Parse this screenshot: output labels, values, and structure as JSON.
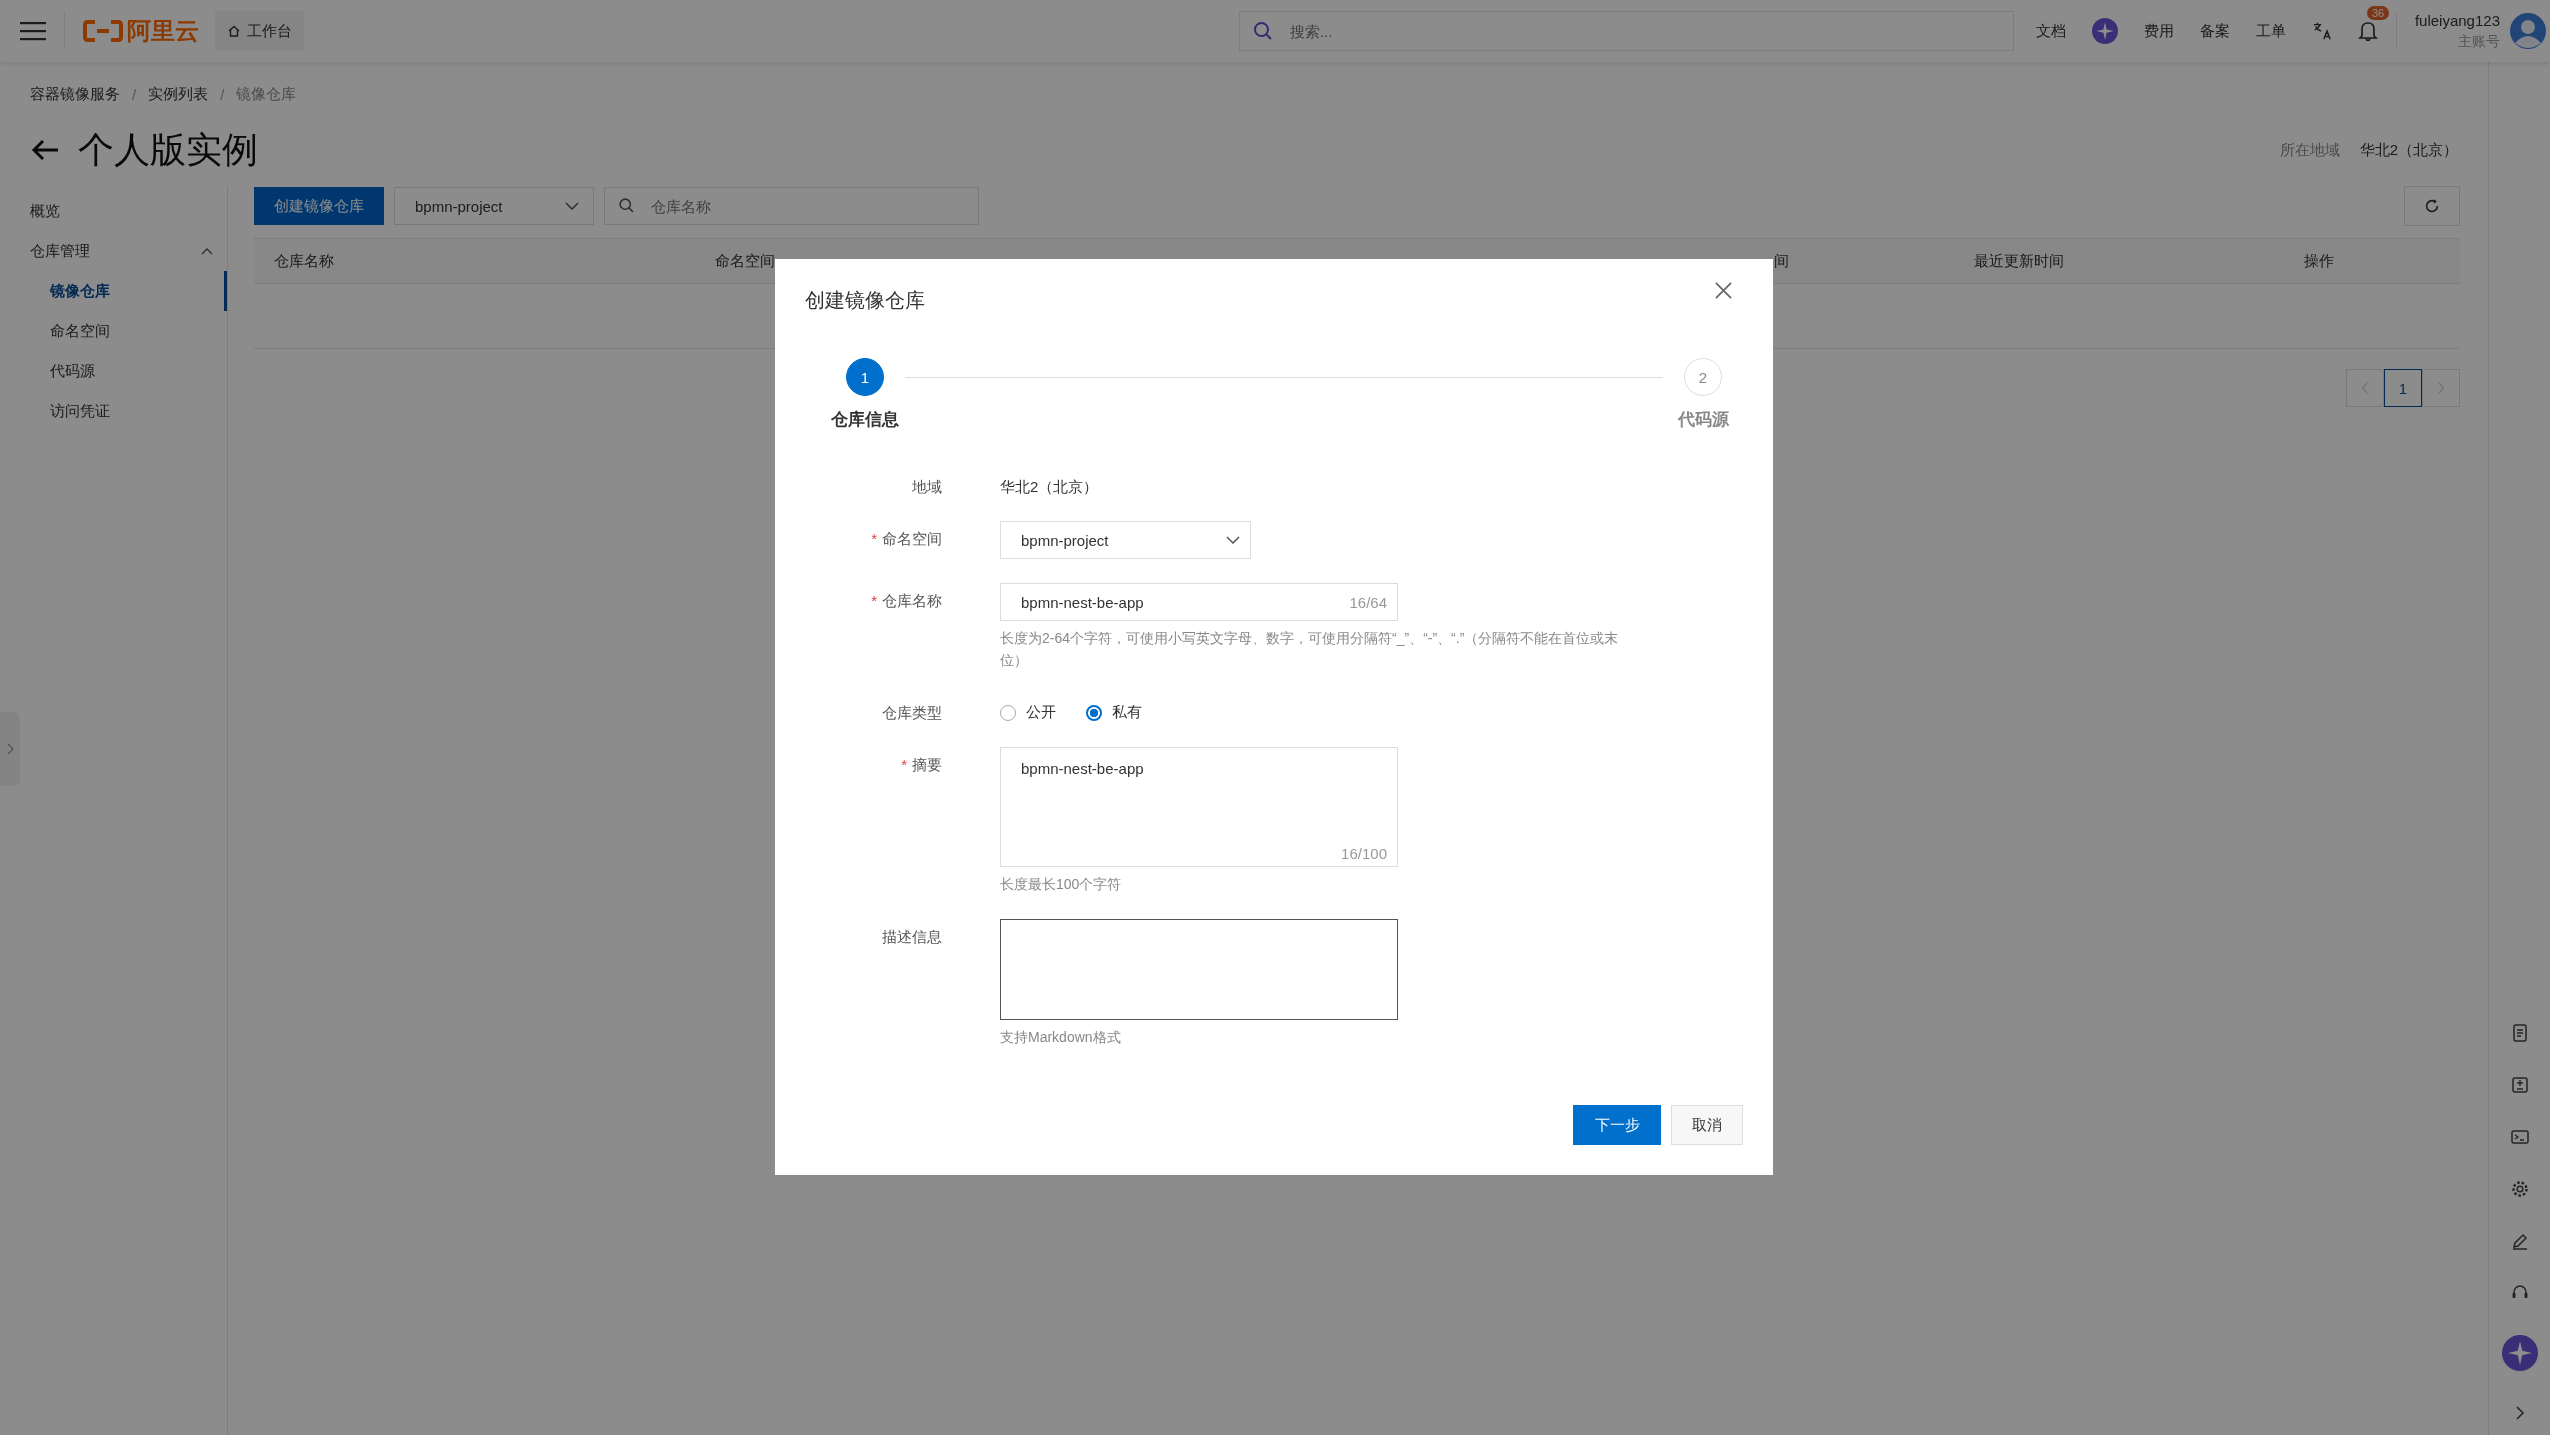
{
  "topbar": {
    "logo": "阿里云",
    "workbench": "工作台",
    "search": {
      "placeholder": "搜索..."
    },
    "items": [
      {
        "kind": "text",
        "label": "文档"
      },
      {
        "kind": "assistant"
      },
      {
        "kind": "text",
        "label": "费用"
      },
      {
        "kind": "text",
        "label": "备案"
      },
      {
        "kind": "text",
        "label": "工单"
      },
      {
        "kind": "translate"
      },
      {
        "kind": "bell",
        "badge": "36"
      }
    ],
    "user": {
      "name": "fuleiyang123",
      "account": "主账号"
    }
  },
  "breadcrumb": {
    "separator": "/",
    "items": [
      {
        "label": "容器镜像服务",
        "selected": false
      },
      {
        "label": "实例列表",
        "selected": false
      },
      {
        "label": "镜像仓库",
        "selected": true
      }
    ]
  },
  "page_title": "个人版实例",
  "region": {
    "label": "所在地域",
    "value": "华北2（北京）"
  },
  "sidebar": {
    "items": [
      {
        "label": "概览",
        "selected": false
      },
      {
        "label": "仓库管理",
        "selected": false,
        "expanded": true,
        "children": [
          {
            "label": "镜像仓库",
            "selected": true
          },
          {
            "label": "命名空间",
            "selected": false
          },
          {
            "label": "代码源",
            "selected": false
          },
          {
            "label": "访问凭证",
            "selected": false
          }
        ]
      }
    ]
  },
  "toolbar": {
    "create_button": "创建镜像仓库",
    "namespace_select": "bpmn-project",
    "search": {
      "placeholder": "仓库名称"
    }
  },
  "table": {
    "columns": [
      "仓库名称",
      "命名空间",
      "间",
      "最近更新时间",
      "操作"
    ]
  },
  "pagination": {
    "pages": [
      {
        "label": "1",
        "selected": true
      }
    ],
    "prev_disabled": true,
    "next_disabled": true
  },
  "dialog": {
    "title": "创建镜像仓库",
    "required_mark": "*",
    "steps": [
      {
        "number": "1",
        "label": "仓库信息",
        "selected": true
      },
      {
        "number": "2",
        "label": "代码源",
        "selected": false
      }
    ],
    "fields": [
      {
        "kind": "text",
        "label": "地域",
        "required": false,
        "value": "华北2（北京）"
      },
      {
        "kind": "select",
        "label": "命名空间",
        "required": true,
        "value": "bpmn-project"
      },
      {
        "kind": "input",
        "label": "仓库名称",
        "required": true,
        "value": "bpmn-nest-be-app",
        "counter": "16/64",
        "hint": "长度为2-64个字符，可使用小写英文字母、数字，可使用分隔符“_”、“-”、“.”（分隔符不能在首位或末位）"
      },
      {
        "kind": "radio",
        "label": "仓库类型",
        "required": false,
        "options": [
          {
            "label": "公开",
            "selected": false
          },
          {
            "label": "私有",
            "selected": true
          }
        ]
      },
      {
        "kind": "textarea",
        "label": "摘要",
        "required": true,
        "value": "bpmn-nest-be-app",
        "counter": "16/100",
        "hint": "长度最长100个字符",
        "focused": false
      },
      {
        "kind": "textarea",
        "label": "描述信息",
        "required": false,
        "hint": "支持Markdown格式",
        "focused": true
      }
    ],
    "buttons": [
      {
        "kind": "primary",
        "label": "下一步"
      },
      {
        "kind": "secondary",
        "label": "取消"
      }
    ]
  }
}
